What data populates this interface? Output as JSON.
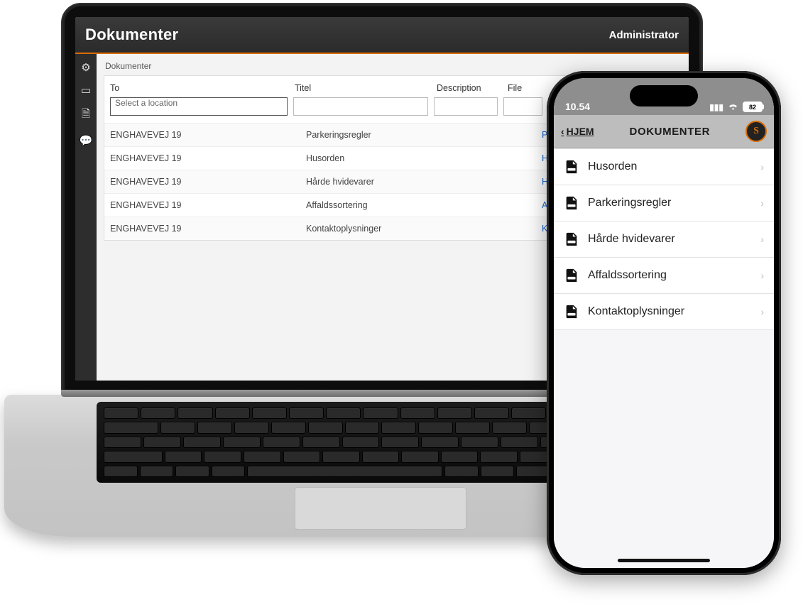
{
  "laptop": {
    "header": {
      "title": "Dokumenter",
      "user": "Administrator"
    },
    "breadcrumb": "Dokumenter",
    "columns": {
      "to": "To",
      "title": "Titel",
      "description": "Description",
      "file": "File"
    },
    "location_placeholder": "Select a location",
    "rows": [
      {
        "to": "ENGHAVEVEJ 19",
        "title": "Parkeringsregler",
        "file": "Parkeringssregler.pdf"
      },
      {
        "to": "ENGHAVEVEJ 19",
        "title": "Husorden",
        "file": "Husordensregler.pdf"
      },
      {
        "to": "ENGHAVEVEJ 19",
        "title": "Hårde hvidevarer",
        "file": "Hårde-hvidevarer.pdf"
      },
      {
        "to": "ENGHAVEVEJ 19",
        "title": "Affaldssortering",
        "file": "Affaldssortering-oversigt"
      },
      {
        "to": "ENGHAVEVEJ 19",
        "title": "Kontaktoplysninger",
        "file": "Kontaktoplysninger.pdf"
      }
    ]
  },
  "phone": {
    "status": {
      "time": "10.54",
      "battery": "82"
    },
    "nav": {
      "back": "HJEM",
      "title": "DOKUMENTER"
    },
    "items": [
      "Husorden",
      "Parkeringsregler",
      "Hårde hvidevarer",
      "Affaldssortering",
      "Kontaktoplysninger"
    ]
  }
}
